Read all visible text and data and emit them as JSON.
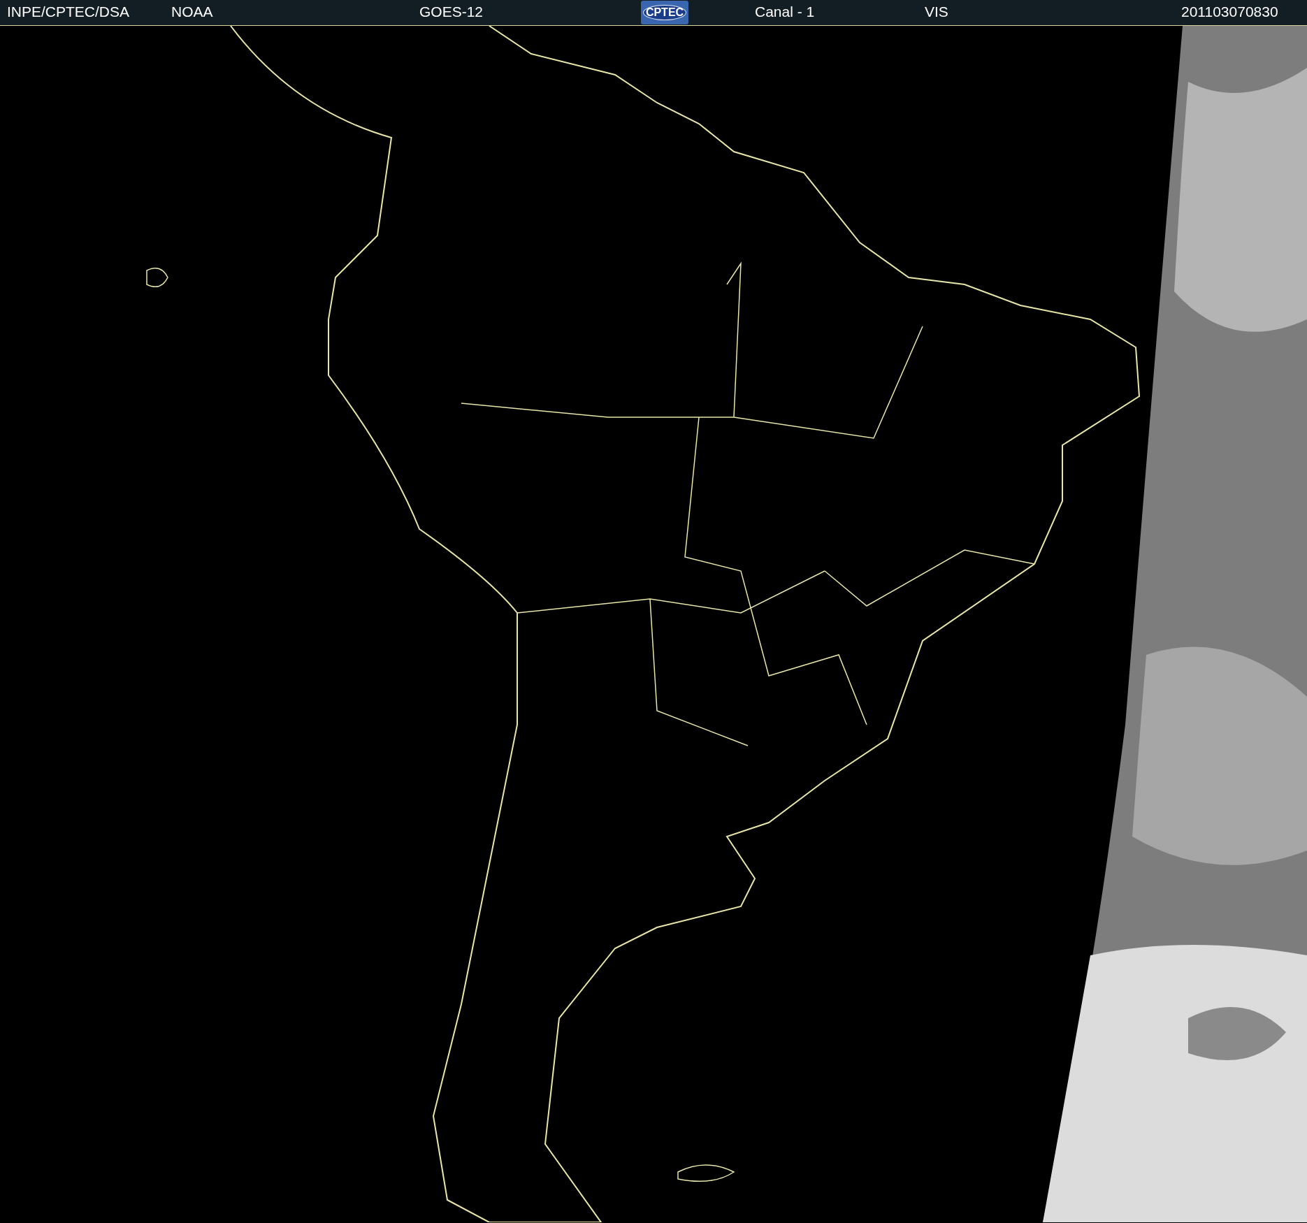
{
  "header": [
    {
      "kind": "text",
      "text": "INPE/CPTEC/DSA"
    },
    {
      "kind": "text",
      "text": "NOAA"
    },
    {
      "kind": "text",
      "text": "GOES-12"
    },
    {
      "kind": "logo",
      "text": "CPTEC"
    },
    {
      "kind": "text",
      "text": "Canal - 1"
    },
    {
      "kind": "text",
      "text": "VIS"
    },
    {
      "kind": "text",
      "text": "201103070830"
    }
  ]
}
